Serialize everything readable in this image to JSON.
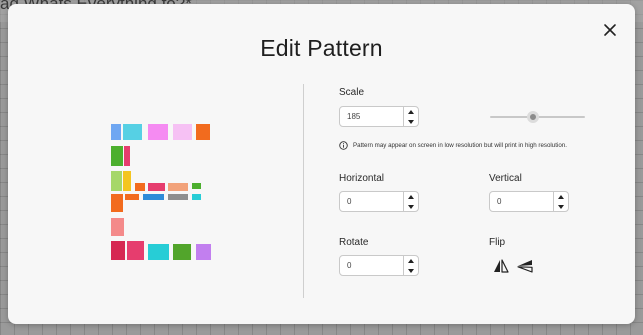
{
  "background": {
    "title": "ag Whats Everything fo?*"
  },
  "modal": {
    "title": "Edit Pattern",
    "close_icon": "close-icon"
  },
  "scale": {
    "label": "Scale",
    "value": "185",
    "slider_fraction": 0.45
  },
  "note": {
    "icon": "info-icon",
    "text": "Pattern may appear on screen in low resolution but will print in high resolution."
  },
  "horizontal": {
    "label": "Horizontal",
    "value": "0"
  },
  "vertical": {
    "label": "Vertical",
    "value": "0"
  },
  "rotate": {
    "label": "Rotate",
    "value": "0"
  },
  "flip": {
    "label": "Flip",
    "horizontal_icon": "flip-horizontal-icon",
    "vertical_icon": "flip-vertical-icon"
  },
  "preview": {
    "colors": [
      "#6fa7f2",
      "#56d0e4",
      "#f58bf2",
      "#f6c1f4",
      "#f26b1e",
      "#4caf2e",
      "#e63d6e",
      "#a6d769",
      "#f4c520",
      "#f2a27a",
      "#f48a8a",
      "#d62752",
      "#27cdd6",
      "#52a52b",
      "#2f8bd8",
      "#c27fef",
      "#8e8e8e"
    ]
  }
}
